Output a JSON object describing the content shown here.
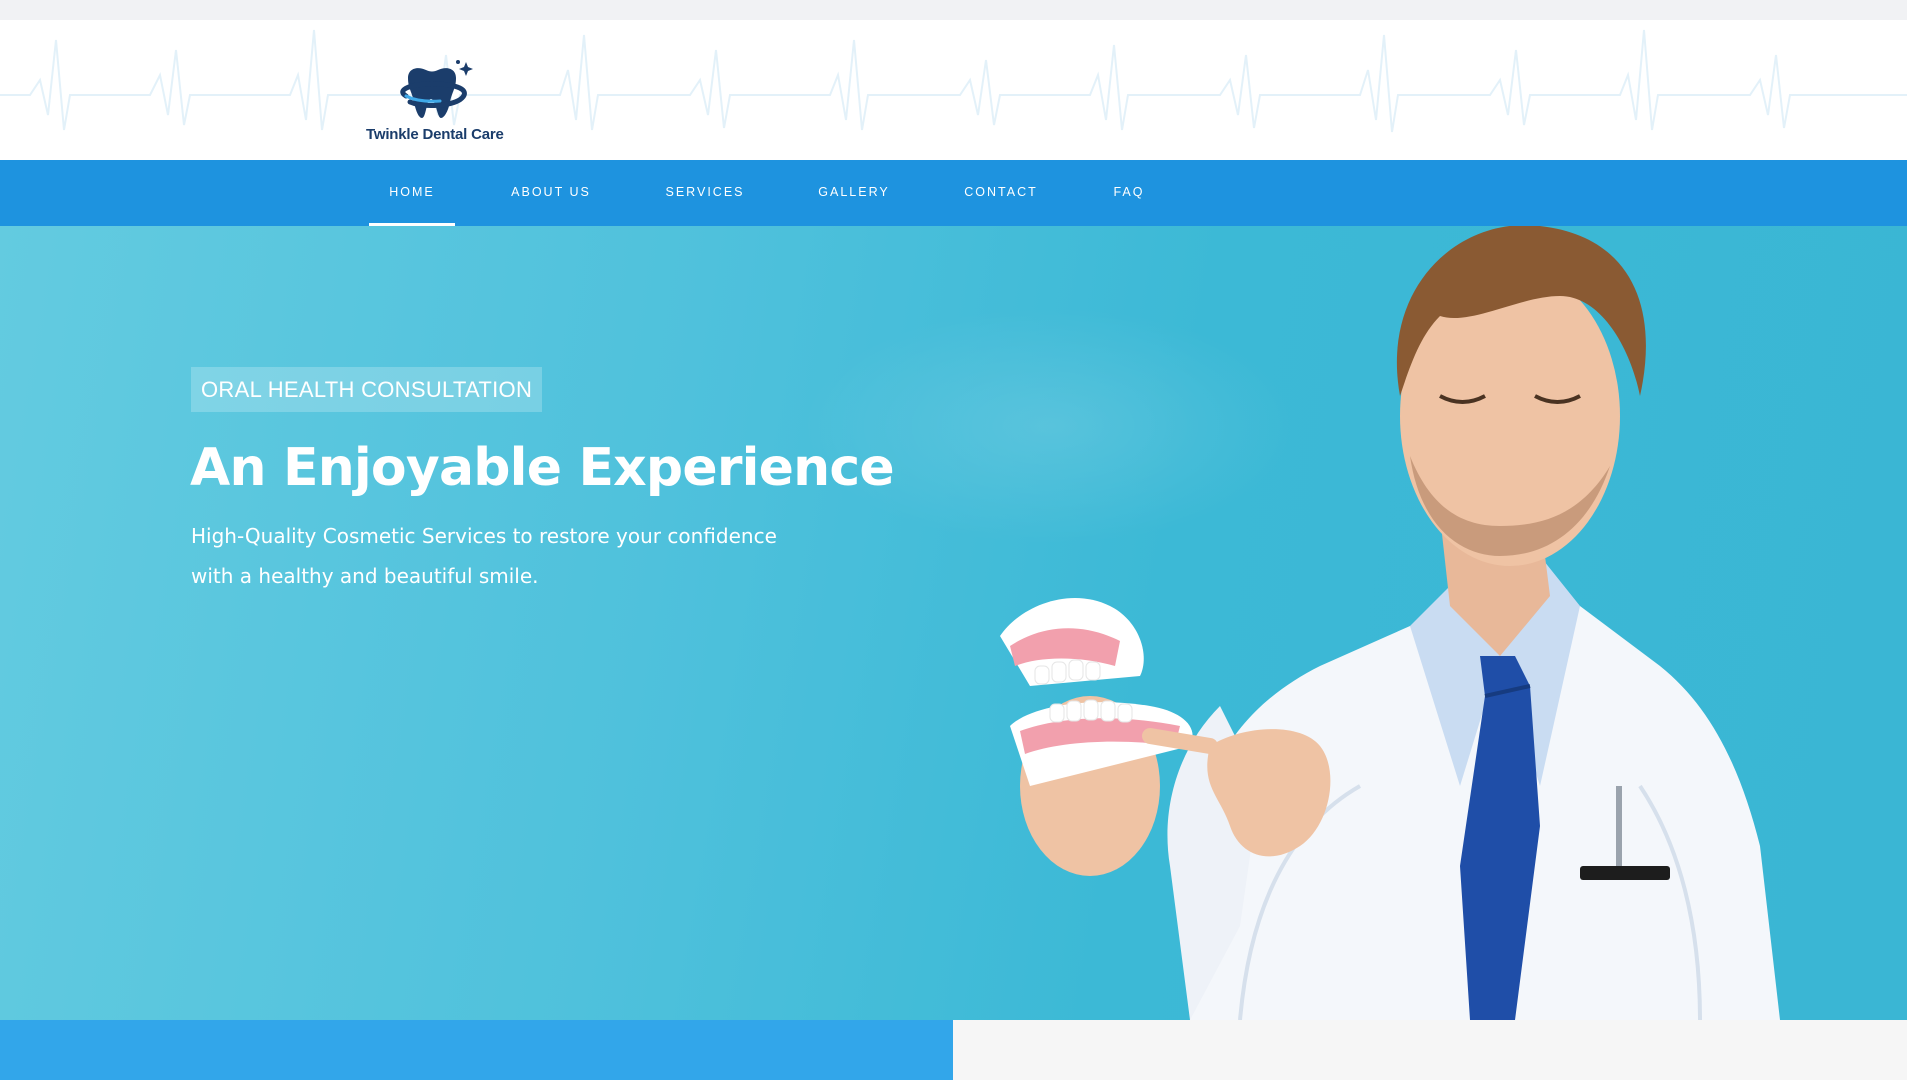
{
  "brand": {
    "name": "Twinkle Dental Care",
    "logo_icon": "tooth-with-sparkle-icon",
    "text_color": "#1b3d6b"
  },
  "nav": {
    "background": "#1e93df",
    "items": [
      {
        "label": "HOME",
        "active": true
      },
      {
        "label": "ABOUT US",
        "active": false
      },
      {
        "label": "SERVICES",
        "active": false
      },
      {
        "label": "GALLERY",
        "active": false
      },
      {
        "label": "CONTACT",
        "active": false
      },
      {
        "label": "FAQ",
        "active": false
      }
    ]
  },
  "hero": {
    "badge": "ORAL HEALTH CONSULTATION",
    "title": "An Enjoyable Experience",
    "subtitle_line1": "High-Quality Cosmetic Services to restore your confidence",
    "subtitle_line2": "with a healthy and beautiful smile.",
    "image": "dentist-holding-denture-model",
    "background": "#4fc1dc"
  },
  "colors": {
    "accent": "#1e93df",
    "bottom_block": "#32a6ea"
  }
}
